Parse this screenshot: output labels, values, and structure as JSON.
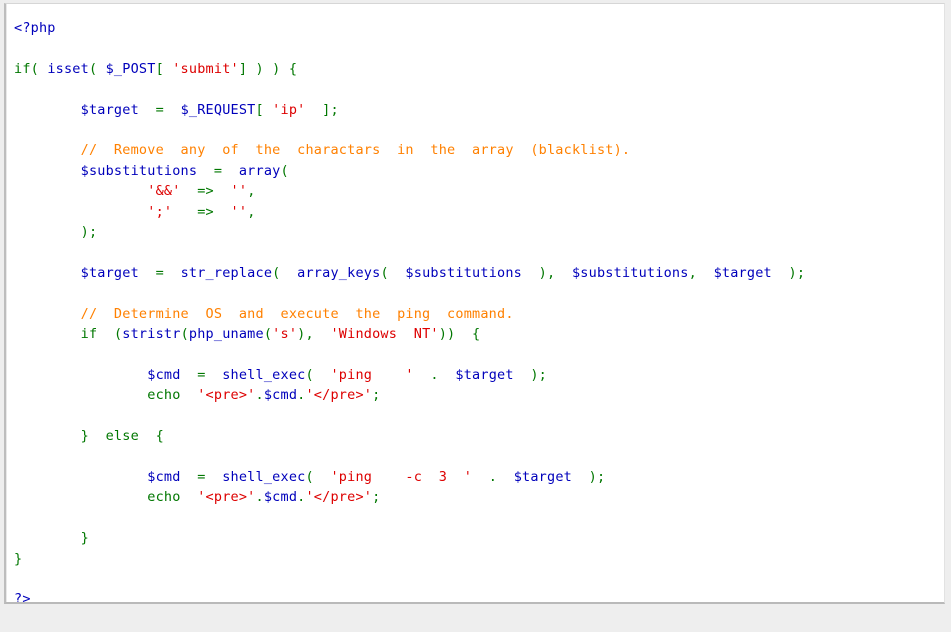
{
  "page": {
    "background_color": "#eeeeee",
    "panel_background": "#ffffff",
    "panel_border_color": "#bdbdbd"
  },
  "theme": {
    "keyword_color": "#007700",
    "function_color": "#0000bb",
    "variable_color": "#0000bb",
    "string_color": "#dd0000",
    "comment_color": "#ff8000",
    "default_color": "#000000"
  },
  "code": {
    "language": "php",
    "open_tag": "<?php",
    "close_tag": "?>",
    "lines": [
      "<?php",
      "",
      "if( isset( $_POST[ 'submit' ] ) ) {",
      "",
      "        $target = $_REQUEST[ 'ip' ];",
      "",
      "        // Remove any of the charactars in the array (blacklist).",
      "        $substitutions = array(",
      "                '&&' => '',",
      "                ';'  => '',",
      "        );",
      "",
      "        $target = str_replace( array_keys( $substitutions ), $substitutions, $target );",
      "",
      "        // Determine OS and execute the ping command.",
      "        if (stristr(php_uname('s'), 'Windows NT')) {",
      "",
      "                $cmd = shell_exec( 'ping  ' . $target );",
      "                echo '<pre>'.$cmd.'</pre>';",
      "",
      "        } else {",
      "",
      "                $cmd = shell_exec( 'ping  -c 3 ' . $target );",
      "                echo '<pre>'.$cmd.'</pre>';",
      "",
      "        }",
      "}",
      "",
      "?>"
    ],
    "comments": [
      "// Remove any of the charactars in the array (blacklist).",
      "// Determine OS and execute the ping command."
    ],
    "strings": [
      "'submit'",
      "'ip'",
      "'&&'",
      "';'",
      "'s'",
      "'Windows NT'",
      "'ping  '",
      "'ping  -c 3 '",
      "'<pre>'",
      "'</pre>'"
    ],
    "variables": [
      "$_POST",
      "$target",
      "$_REQUEST",
      "$substitutions",
      "$cmd"
    ],
    "functions": [
      "isset",
      "array",
      "str_replace",
      "array_keys",
      "stristr",
      "php_uname",
      "shell_exec"
    ],
    "keywords": [
      "if",
      "else",
      "echo"
    ]
  }
}
